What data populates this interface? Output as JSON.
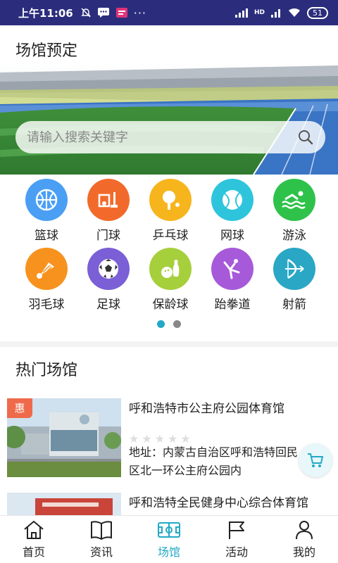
{
  "status_bar": {
    "time": "上午11:06",
    "network": "HD",
    "battery": "51"
  },
  "header": {
    "title": "场馆预定"
  },
  "search": {
    "placeholder": "请输入搜索关键字"
  },
  "categories": [
    {
      "label": "篮球",
      "icon": "basketball-icon",
      "color": "#4a9ff5"
    },
    {
      "label": "门球",
      "icon": "gateball-icon",
      "color": "#f26a2b"
    },
    {
      "label": "乒乓球",
      "icon": "ping-pong-icon",
      "color": "#f7b51d"
    },
    {
      "label": "网球",
      "icon": "tennis-icon",
      "color": "#2ec5dc"
    },
    {
      "label": "游泳",
      "icon": "swimming-icon",
      "color": "#2fc24a"
    },
    {
      "label": "羽毛球",
      "icon": "badminton-icon",
      "color": "#f7921e"
    },
    {
      "label": "足球",
      "icon": "football-icon",
      "color": "#7b5fd6"
    },
    {
      "label": "保龄球",
      "icon": "bowling-icon",
      "color": "#a6cf3c"
    },
    {
      "label": "跆拳道",
      "icon": "taekwondo-icon",
      "color": "#a65ad9"
    },
    {
      "label": "射箭",
      "icon": "archery-icon",
      "color": "#2aa7c4"
    }
  ],
  "carousel": {
    "page": 1,
    "total": 2
  },
  "hot_section": {
    "title": "热门场馆"
  },
  "venues": [
    {
      "badge": "惠",
      "name": "呼和浩特市公主府公园体育馆",
      "rating": 0,
      "address": "地址：内蒙古自治区呼和浩特回民区北一环公主府公园内"
    },
    {
      "badge": "",
      "name": "呼和浩特全民健身中心综合体育馆",
      "rating": 0,
      "address": ""
    }
  ],
  "tabs": [
    {
      "label": "首页",
      "icon": "home-icon"
    },
    {
      "label": "资讯",
      "icon": "book-icon"
    },
    {
      "label": "场馆",
      "icon": "stadium-icon"
    },
    {
      "label": "活动",
      "icon": "flag-icon"
    },
    {
      "label": "我的",
      "icon": "user-icon"
    }
  ],
  "active_tab": "场馆",
  "colors": {
    "status_bar": "#2b2d7c",
    "accent": "#22a9c6",
    "badge": "#ef6a4a"
  }
}
